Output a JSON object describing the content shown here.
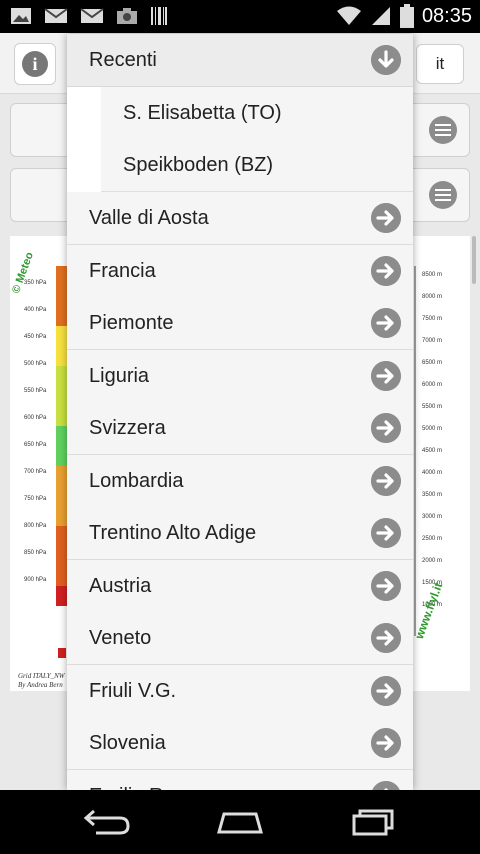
{
  "status_bar": {
    "time": "08:35",
    "left_icons": [
      "image-icon",
      "mail-icon",
      "mail-icon",
      "camera-icon",
      "barcode-icon"
    ],
    "right_icons": [
      "wifi-icon",
      "signal-icon",
      "battery-icon"
    ]
  },
  "app_bar": {
    "info_icon": "info-icon",
    "language_button": "it"
  },
  "dropdown": {
    "header": "Recenti",
    "header_icon": "arrow-down-icon",
    "recent_items": [
      "S. Elisabetta (TO)",
      "Speikboden (BZ)"
    ],
    "items": [
      "Valle di Aosta",
      "Francia",
      "Piemonte",
      "Liguria",
      "Svizzera",
      "Lombardia",
      "Trentino Alto Adige",
      "Austria",
      "Veneto",
      "Friuli V.G.",
      "Slovenia",
      "Emilia R."
    ],
    "item_icon": "arrow-right-icon"
  },
  "background_chart": {
    "left_axis": [
      "350 hPa",
      "400 hPa",
      "450 hPa",
      "500 hPa",
      "550 hPa",
      "600 hPa",
      "650 hPa",
      "700 hPa",
      "750 hPa",
      "800 hPa",
      "850 hPa",
      "900 hPa"
    ],
    "right_axis": [
      "8500 m",
      "8000 m",
      "7500 m",
      "7000 m",
      "6500 m",
      "6000 m",
      "5500 m",
      "5000 m",
      "4500 m",
      "4000 m",
      "3500 m",
      "3000 m",
      "2500 m",
      "2000 m",
      "1500 m",
      "1000 m"
    ],
    "watermark_left": "© Meteo",
    "watermark_right": "www.flyl.it",
    "footer_lines": [
      "Grid ITALY_NW",
      "By Andrea Bern"
    ]
  },
  "colors": {
    "accent_grey": "#8c8c8c",
    "status_bar": "#000000",
    "watermark_green": "#2e9a2e"
  }
}
